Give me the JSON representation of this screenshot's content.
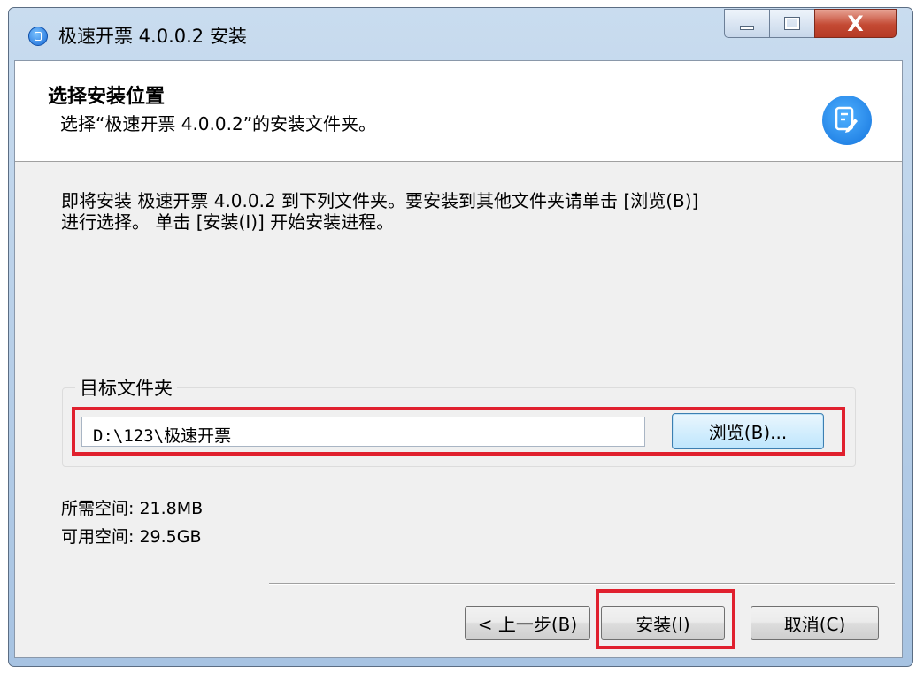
{
  "window": {
    "title": "极速开票 4.0.0.2 安装",
    "close_glyph": "X"
  },
  "header": {
    "title": "选择安装位置",
    "subtitle": "选择“极速开票 4.0.0.2”的安装文件夹。",
    "icon": "document-edit-icon"
  },
  "description": {
    "line1": "即将安装 极速开票 4.0.0.2 到下列文件夹。要安装到其他文件夹请单击 [浏览(B)]",
    "line2": "进行选择。 单击 [安装(I)] 开始安装进程。"
  },
  "target_folder": {
    "legend": "目标文件夹",
    "path_value": "D:\\123\\极速开票",
    "browse_label": "浏览(B)..."
  },
  "space": {
    "required": "所需空间: 21.8MB",
    "available": "可用空间: 29.5GB"
  },
  "buttons": {
    "back_label": "< 上一步(B)",
    "install_label": "安装(I)",
    "cancel_label": "取消(C)"
  },
  "colors": {
    "highlight": "#e0202e",
    "accent": "#1474dd"
  }
}
